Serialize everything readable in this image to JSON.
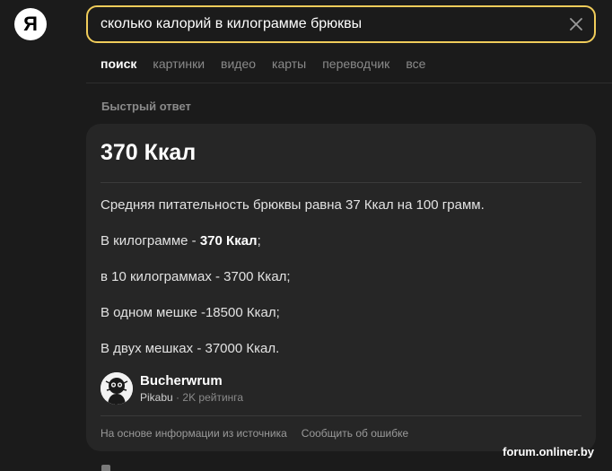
{
  "logo": {
    "letter": "Я"
  },
  "search": {
    "value": "сколько калорий в килограмме брюквы",
    "clear_icon": "close-icon"
  },
  "tabs": [
    {
      "label": "поиск",
      "active": true
    },
    {
      "label": "картинки",
      "active": false
    },
    {
      "label": "видео",
      "active": false
    },
    {
      "label": "карты",
      "active": false
    },
    {
      "label": "переводчик",
      "active": false
    },
    {
      "label": "все",
      "active": false
    }
  ],
  "quick_answer": {
    "section_label": "Быстрый ответ",
    "title": "370 Ккал",
    "line1": "Средняя питательность брюквы равна 37 Ккал на 100 грамм.",
    "line2_prefix": "В килограмме - ",
    "line2_bold": "370 Ккал",
    "line2_suffix": ";",
    "line3": "в 10 килограммах - 3700 Ккал;",
    "line4": "В одном мешке -18500 Ккал;",
    "line5": "В двух мешках - 37000 Ккал.",
    "author": {
      "name": "Bucherwrum",
      "site": "Pikabu",
      "separator": "·",
      "rating": "2K рейтинга"
    },
    "footer": {
      "source_note": "На основе информации из источника",
      "report_link": "Сообщить об ошибке"
    }
  },
  "watermark": "forum.onliner.by",
  "colors": {
    "background": "#1b1b1b",
    "card": "#262626",
    "search_border": "#f0cc5a"
  }
}
